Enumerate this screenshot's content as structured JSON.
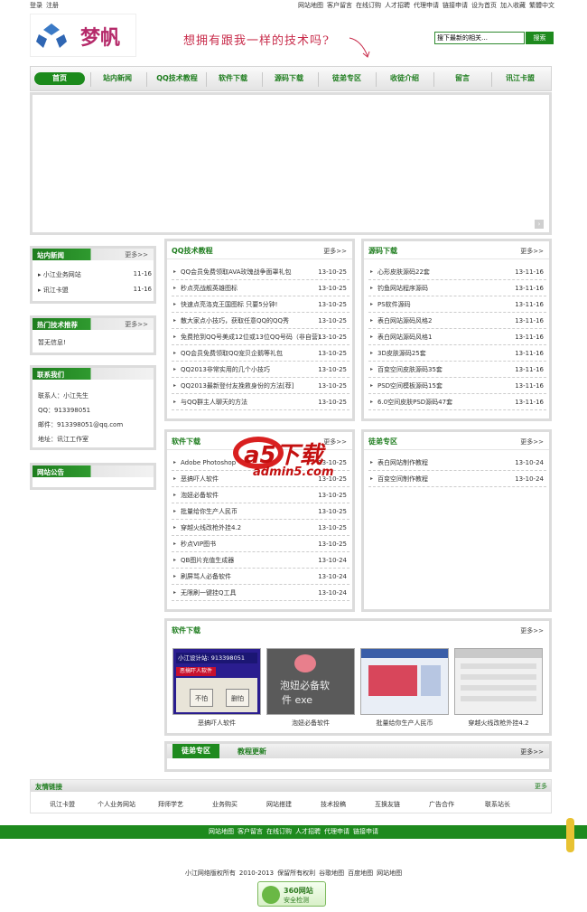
{
  "topbar": {
    "left": [
      "登录",
      "注册"
    ],
    "right": [
      "网站地图",
      "客户留言",
      "在线订购",
      "人才招聘",
      "代理申请",
      "链接申请",
      "设为首页",
      "加入收藏",
      "繁體中文"
    ]
  },
  "logo": {
    "text": "梦帆"
  },
  "slogan": "想拥有跟我一样的技术吗?",
  "search": {
    "value": "搜下最新的相关…",
    "button": "搜索"
  },
  "nav": [
    "首页",
    "站内新闻",
    "QQ技术教程",
    "软件下载",
    "源码下载",
    "徒弟专区",
    "收徒介绍",
    "留言",
    "讯江卡盟"
  ],
  "news": {
    "title": "站内新闻",
    "more": "更多>>",
    "items": [
      {
        "t": "小江业务网站",
        "d": "11-16"
      },
      {
        "t": "讯江卡盟",
        "d": "11-16"
      }
    ]
  },
  "hot": {
    "title": "热门技术推荐",
    "more": "更多>>",
    "empty": "暂无信息!"
  },
  "contact": {
    "title": "联系我们",
    "lines": [
      "联系人：小江先生",
      "QQ：913398051",
      "邮件：913398051@qq.com",
      "地址：讯江工作室"
    ]
  },
  "notice": {
    "title": "网站公告"
  },
  "qq": {
    "title": "QQ技术教程",
    "more": "更多>>",
    "items": [
      {
        "t": "QQ会员免费领取AVA玫瑰战争面罩礼包",
        "d": "13-10-25"
      },
      {
        "t": "秒点亮战舰英雄图标",
        "d": "13-10-25"
      },
      {
        "t": "快速点亮洛克王国图标 只要5分钟!",
        "d": "13-10-25"
      },
      {
        "t": "散大家点小技巧，获取任意QQ的QQ秀",
        "d": "13-10-25"
      },
      {
        "t": "免费抢到QQ号美成12位或13位QQ号码（非自营）",
        "d": "13-10-25"
      },
      {
        "t": "QQ会员免费领取QQ宠贝企鹅等礼包",
        "d": "13-10-25"
      },
      {
        "t": "QQ2013非常实用的几个小技巧",
        "d": "13-10-25"
      },
      {
        "t": "QQ2013最新登付友挽救身份的方法[荐]",
        "d": "13-10-25"
      },
      {
        "t": "与QQ群主人聊天的方法",
        "d": "13-10-25"
      }
    ]
  },
  "source": {
    "title": "源码下载",
    "more": "更多>>",
    "items": [
      {
        "t": "心形皮肤源码22套",
        "d": "13-11-16"
      },
      {
        "t": "钓鱼网站程序源码",
        "d": "13-11-16"
      },
      {
        "t": "PS软件源码",
        "d": "13-11-16"
      },
      {
        "t": "表白网站源码风格2",
        "d": "13-11-16"
      },
      {
        "t": "表白网站源码风格1",
        "d": "13-11-16"
      },
      {
        "t": "3D皮肤源码25套",
        "d": "13-11-16"
      },
      {
        "t": "百变空间皮肤源码35套",
        "d": "13-11-16"
      },
      {
        "t": "PSD空间模板源码15套",
        "d": "13-11-16"
      },
      {
        "t": "6.0空间皮肤PSD源码47套",
        "d": "13-11-16"
      }
    ]
  },
  "soft": {
    "title": "软件下载",
    "more": "更多>>",
    "items": [
      {
        "t": "Adobe Photoshop",
        "d": "13-10-25"
      },
      {
        "t": "恶搞吓人软件",
        "d": "13-10-25"
      },
      {
        "t": "泡妞必备软件",
        "d": "13-10-25"
      },
      {
        "t": "批量给你生产人民币",
        "d": "13-10-25"
      },
      {
        "t": "穿越火线改枪外挂4.2",
        "d": "13-10-25"
      },
      {
        "t": "秒点VIP图书",
        "d": "13-10-25"
      },
      {
        "t": "QB图片充值生成器",
        "d": "13-10-24"
      },
      {
        "t": "刷屏骂人必备软件",
        "d": "13-10-24"
      },
      {
        "t": "无限刷一键挂Q工具",
        "d": "13-10-24"
      }
    ]
  },
  "disciple": {
    "title": "徒弟专区",
    "more": "更多>>",
    "items": [
      {
        "t": "表白网站制作教程",
        "d": "13-10-24"
      },
      {
        "t": "百变空间制作教程",
        "d": "13-10-24"
      }
    ]
  },
  "gallery": {
    "title": "软件下载",
    "more": "更多>>",
    "items": [
      "恶搞吓人软件",
      "泡妞必备软件",
      "批量给你生产人民币",
      "穿越火线改枪外挂4.2"
    ],
    "thumb1": {
      "line1": "小江设计站: 913398051",
      "line2": "恶搞吓人软件",
      "b1": "不怕",
      "b2": "删怕"
    },
    "thumb2": {
      "line1": "泡妞必备软",
      "line2": "件 exe"
    }
  },
  "tabs": {
    "items": [
      "徒弟专区",
      "教程更新"
    ],
    "more": "更多>>"
  },
  "watermark": {
    "main": "a5下载",
    "sub": "admin5.com"
  },
  "friends": {
    "title": "友情链接",
    "more": "更多",
    "items": [
      "讯江卡盟",
      "个人业务网站",
      "拜师学艺",
      "业务购买",
      "网站搭建",
      "技术投稿",
      "互换友链",
      "广告合作",
      "联系站长"
    ]
  },
  "footerbar": [
    "网站地图",
    "客户留言",
    "在线订购",
    "人才招聘",
    "代理申请",
    "链接申请"
  ],
  "copyright": [
    "小江网络版权所有",
    "2010-2013",
    "保留所有权利",
    "谷歌地图",
    "百度地图",
    "网站地图"
  ],
  "badge": {
    "l1": "360网站",
    "l2": "安全检测"
  },
  "colors": {
    "green": "#1e8a1e",
    "pink": "#c82b4a",
    "logo": "#b52a6a"
  }
}
